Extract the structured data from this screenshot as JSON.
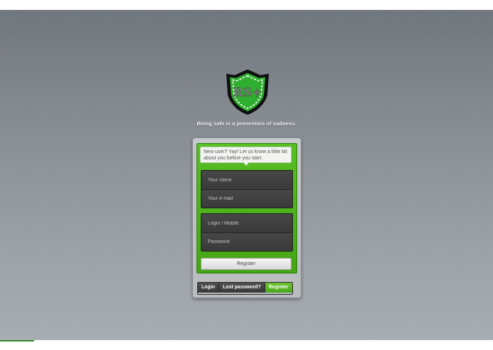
{
  "logo": {
    "text": "RS+",
    "icon": "shield-logo-icon",
    "colors": {
      "shield": "#2fae2f",
      "border": "#101010",
      "stitch": "#ffffff",
      "letters": "#7d7d7d"
    }
  },
  "tagline": "Being safe is a prevention of sadness.",
  "form": {
    "intro": "New user? Yay! Let us know a little bit about you before you start.",
    "fields": {
      "name_placeholder": "Your name",
      "email_placeholder": "Your e-mail",
      "login_placeholder": "Login / Mobile",
      "password_placeholder": "Password"
    },
    "submit_label": "Register"
  },
  "tabs": [
    {
      "label": "Login",
      "active": false
    },
    {
      "label": "Lost password?",
      "active": false
    },
    {
      "label": "Register",
      "active": true
    }
  ],
  "colors": {
    "accent": "#4fb31f",
    "panel_dark": "#3f3f3f",
    "background": "#868c92"
  }
}
